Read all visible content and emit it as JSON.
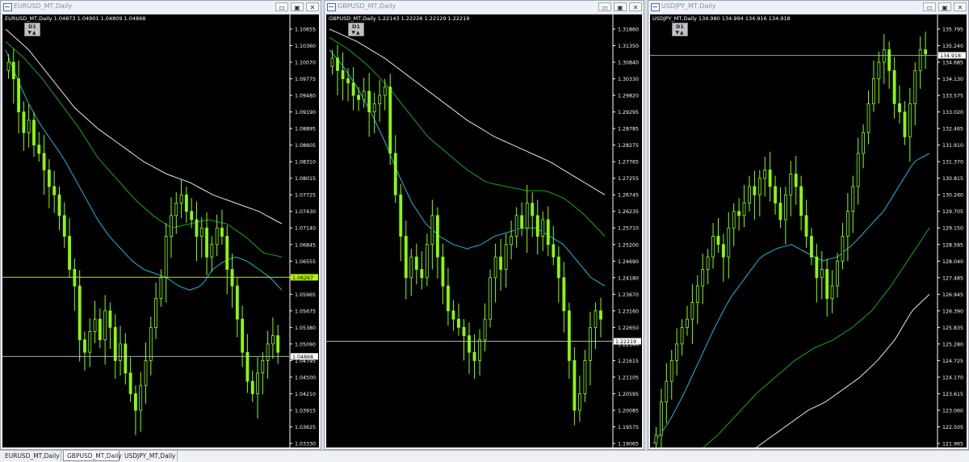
{
  "windows": [
    {
      "title": "EURUSD_MT,Daily",
      "info": "EURUSD_MT,Daily  1.04873 1.04901 1.04809 1.04868",
      "timeframe": "D1",
      "price_labels": [
        "1.10655",
        "1.10360",
        "1.10070",
        "1.09775",
        "1.09480",
        "1.09190",
        "1.08895",
        "1.08605",
        "1.08310",
        "1.08015",
        "1.07725",
        "1.07430",
        "1.07140",
        "1.06845",
        "1.06555",
        "1.06265",
        "1.05965",
        "1.05675",
        "1.05380",
        "1.05090",
        "1.04795",
        "1.04500",
        "1.04210",
        "1.03915",
        "1.03625",
        "1.03330"
      ],
      "current_price": "1.04868",
      "hline_price": "1.06267",
      "hline_color": "#b6f000",
      "price_max": 1.10655,
      "price_min": 1.0333
    },
    {
      "title": "GBPUSD_MT,Daily",
      "info": "GBPUSD_MT,Daily  1.22143 1.22226 1.22129 1.22219",
      "timeframe": "D1",
      "price_labels": [
        "1.31860",
        "1.31350",
        "1.30840",
        "1.30330",
        "1.29820",
        "1.29295",
        "1.28785",
        "1.28275",
        "1.27765",
        "1.27255",
        "1.26745",
        "1.26235",
        "1.25710",
        "1.25200",
        "1.24690",
        "1.24180",
        "1.23670",
        "1.23160",
        "1.22650",
        "1.22140",
        "1.21615",
        "1.21105",
        "1.20595",
        "1.20085",
        "1.19575",
        "1.19065"
      ],
      "current_price": "1.22219",
      "hline_price": null,
      "hline_color": "#c8c8c8",
      "price_max": 1.3186,
      "price_min": 1.19065
    },
    {
      "title": "USDJPY_MT,Daily",
      "info": "USDJPY_MT,Daily  134.980 134.994 134.916 134.918",
      "timeframe": "D1",
      "price_labels": [
        "135.795",
        "135.240",
        "134.685",
        "134.130",
        "133.575",
        "133.020",
        "132.465",
        "131.910",
        "131.370",
        "130.815",
        "130.260",
        "129.705",
        "129.150",
        "128.595",
        "128.040",
        "127.485",
        "126.945",
        "126.390",
        "125.835",
        "125.280",
        "124.725",
        "124.170",
        "123.615",
        "123.060",
        "122.505",
        "121.965"
      ],
      "current_price": "134.918",
      "hline_price": null,
      "hline_color": "#c8c8c8",
      "price_max": 135.795,
      "price_min": 121.965
    }
  ],
  "tabs": [
    {
      "label": "EURUSD_MT,Daily",
      "active": false
    },
    {
      "label": "GBPUSD_MT,Daily",
      "active": true
    },
    {
      "label": "USDJPY_MT,Daily",
      "active": false
    }
  ],
  "colors": {
    "candle": "#8cff00",
    "ma_blue": "#1fb4e0",
    "ma_green": "#18a818",
    "ma_white": "#e8e8e8",
    "background": "#000000"
  }
}
